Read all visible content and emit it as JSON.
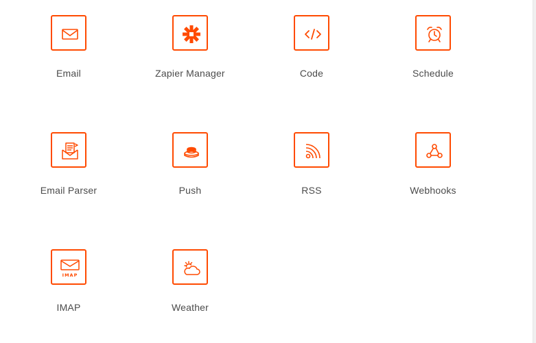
{
  "apps": [
    {
      "label": "Email",
      "icon": "email-icon"
    },
    {
      "label": "Zapier Manager",
      "icon": "zapier-asterisk-icon"
    },
    {
      "label": "Code",
      "icon": "code-icon"
    },
    {
      "label": "Schedule",
      "icon": "alarm-clock-icon"
    },
    {
      "label": "Email Parser",
      "icon": "email-parser-icon"
    },
    {
      "label": "Push",
      "icon": "push-button-icon"
    },
    {
      "label": "RSS",
      "icon": "rss-icon"
    },
    {
      "label": "Webhooks",
      "icon": "webhooks-icon"
    },
    {
      "label": "IMAP",
      "icon": "imap-icon",
      "icon_text": "IMAP"
    },
    {
      "label": "Weather",
      "icon": "weather-icon"
    }
  ],
  "colors": {
    "accent": "#ff4a00",
    "label": "#4b4b4b",
    "background": "#ffffff"
  }
}
